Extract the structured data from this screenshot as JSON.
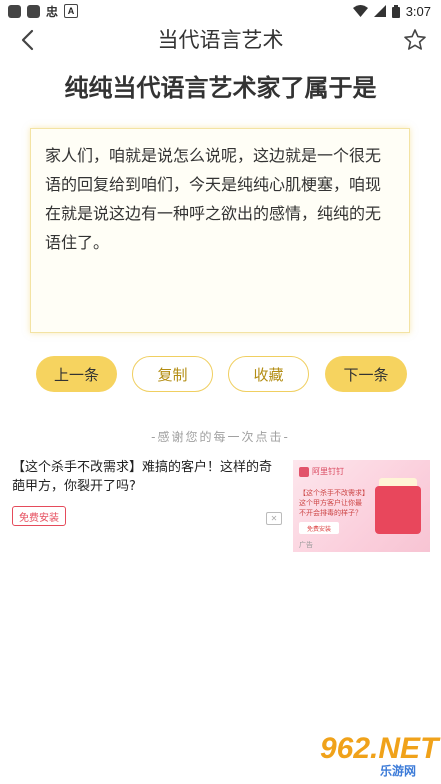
{
  "status_bar": {
    "time": "3:07",
    "icons": [
      "square-icon",
      "square-icon",
      "sim-icon",
      "a-icon",
      "wifi-icon",
      "signal-icon",
      "battery-icon"
    ],
    "glyph": "忠",
    "a_letter": "A"
  },
  "header": {
    "title": "当代语言艺术"
  },
  "headline": "纯纯当代语言艺术家了属于是",
  "card": {
    "text": "家人们，咱就是说怎么说呢，这边就是一个很无语的回复给到咱们，今天是纯纯心肌梗塞，咱现在就是说这边有一种呼之欲出的感情，纯纯的无语住了。"
  },
  "buttons": {
    "prev": "上一条",
    "copy": "复制",
    "favorite": "收藏",
    "next": "下一条"
  },
  "thanks": "-感谢您的每一次点击-",
  "ad": {
    "text": "【这个杀手不改需求】难搞的客户！这样的奇葩甲方，你裂开了吗?",
    "install": "免费安装",
    "image": {
      "brand": "阿里钉钉",
      "mini_text": "【这个杀手不改需求】这个甲方客户让你最不开会排毒的样子？",
      "mini_button": "免费安装",
      "label": "广告"
    }
  },
  "watermark": {
    "brand": "962.NET",
    "sub": "乐游网"
  },
  "colors": {
    "accent": "#f6d35f",
    "accent_text": "#b38d13",
    "card_border": "#f3e3a3"
  }
}
